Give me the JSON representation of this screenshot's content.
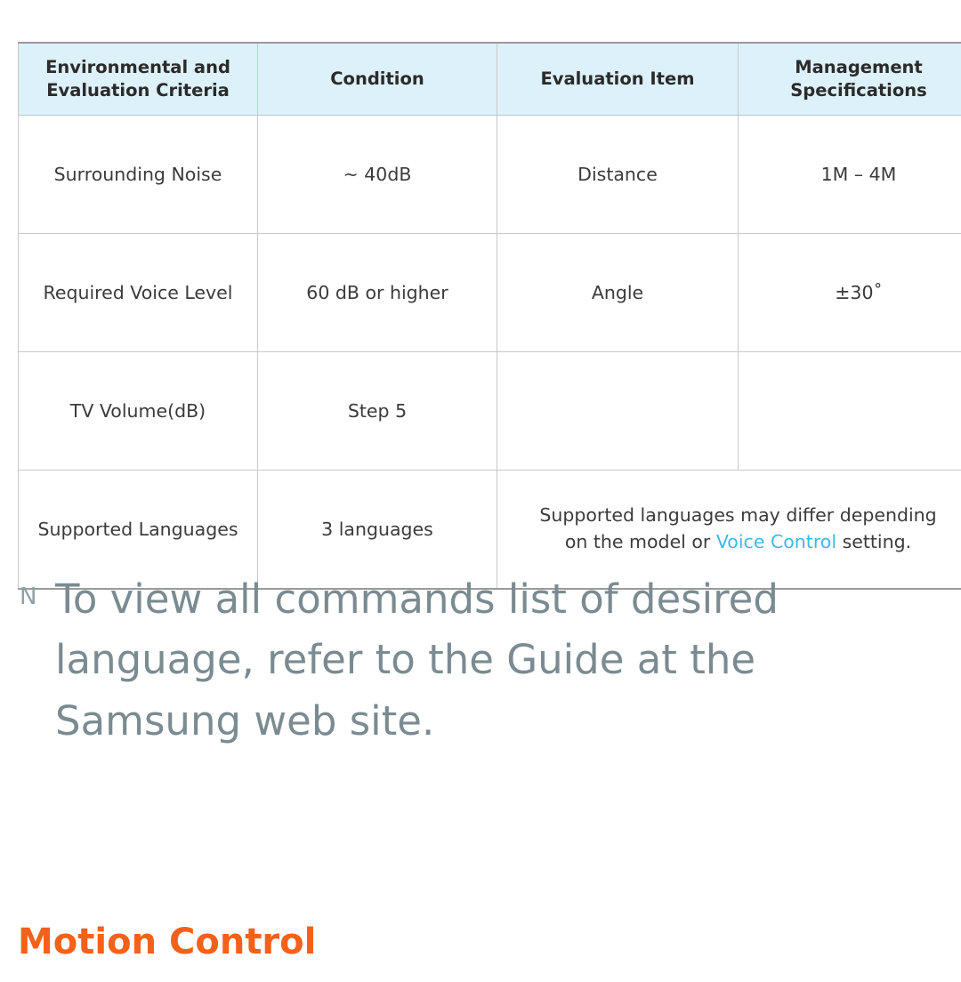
{
  "table": {
    "headers": [
      "Environmental and Evaluation Criteria",
      "Condition",
      "Evaluation Item",
      "Management Specifications"
    ],
    "headers_lines": {
      "h1_line1": "Environmental and",
      "h1_line2": "Evaluation Criteria",
      "h2": "Condition",
      "h3": "Evaluation Item",
      "h4_line1": "Management",
      "h4_line2": "Specifications"
    },
    "rows": [
      {
        "criteria": "Surrounding Noise",
        "condition": "~ 40dB",
        "evaluation_item": "Distance",
        "management_spec": "1M – 4M"
      },
      {
        "criteria": "Required Voice Level",
        "condition": "60 dB or higher",
        "evaluation_item": "Angle",
        "management_spec": "±30˚"
      },
      {
        "criteria": "TV Volume(dB)",
        "condition": "Step 5",
        "evaluation_item": "",
        "management_spec": ""
      },
      {
        "criteria": "Supported Languages",
        "condition": "3 languages",
        "note_line1_before": "Supported languages may differ depending",
        "note_line2_before": "on the model or ",
        "note_link": "Voice Control",
        "note_line2_after": " setting."
      }
    ]
  },
  "note": {
    "marker": "N",
    "text": "To view all commands list of desired language, refer to the Guide at the Samsung web site."
  },
  "section": {
    "heading": "Motion Control"
  },
  "colors": {
    "header_background": "#ddf1fa",
    "accent_link": "#3cb9e8",
    "heading_orange": "#f4611a",
    "note_text": "#7a8b91"
  }
}
